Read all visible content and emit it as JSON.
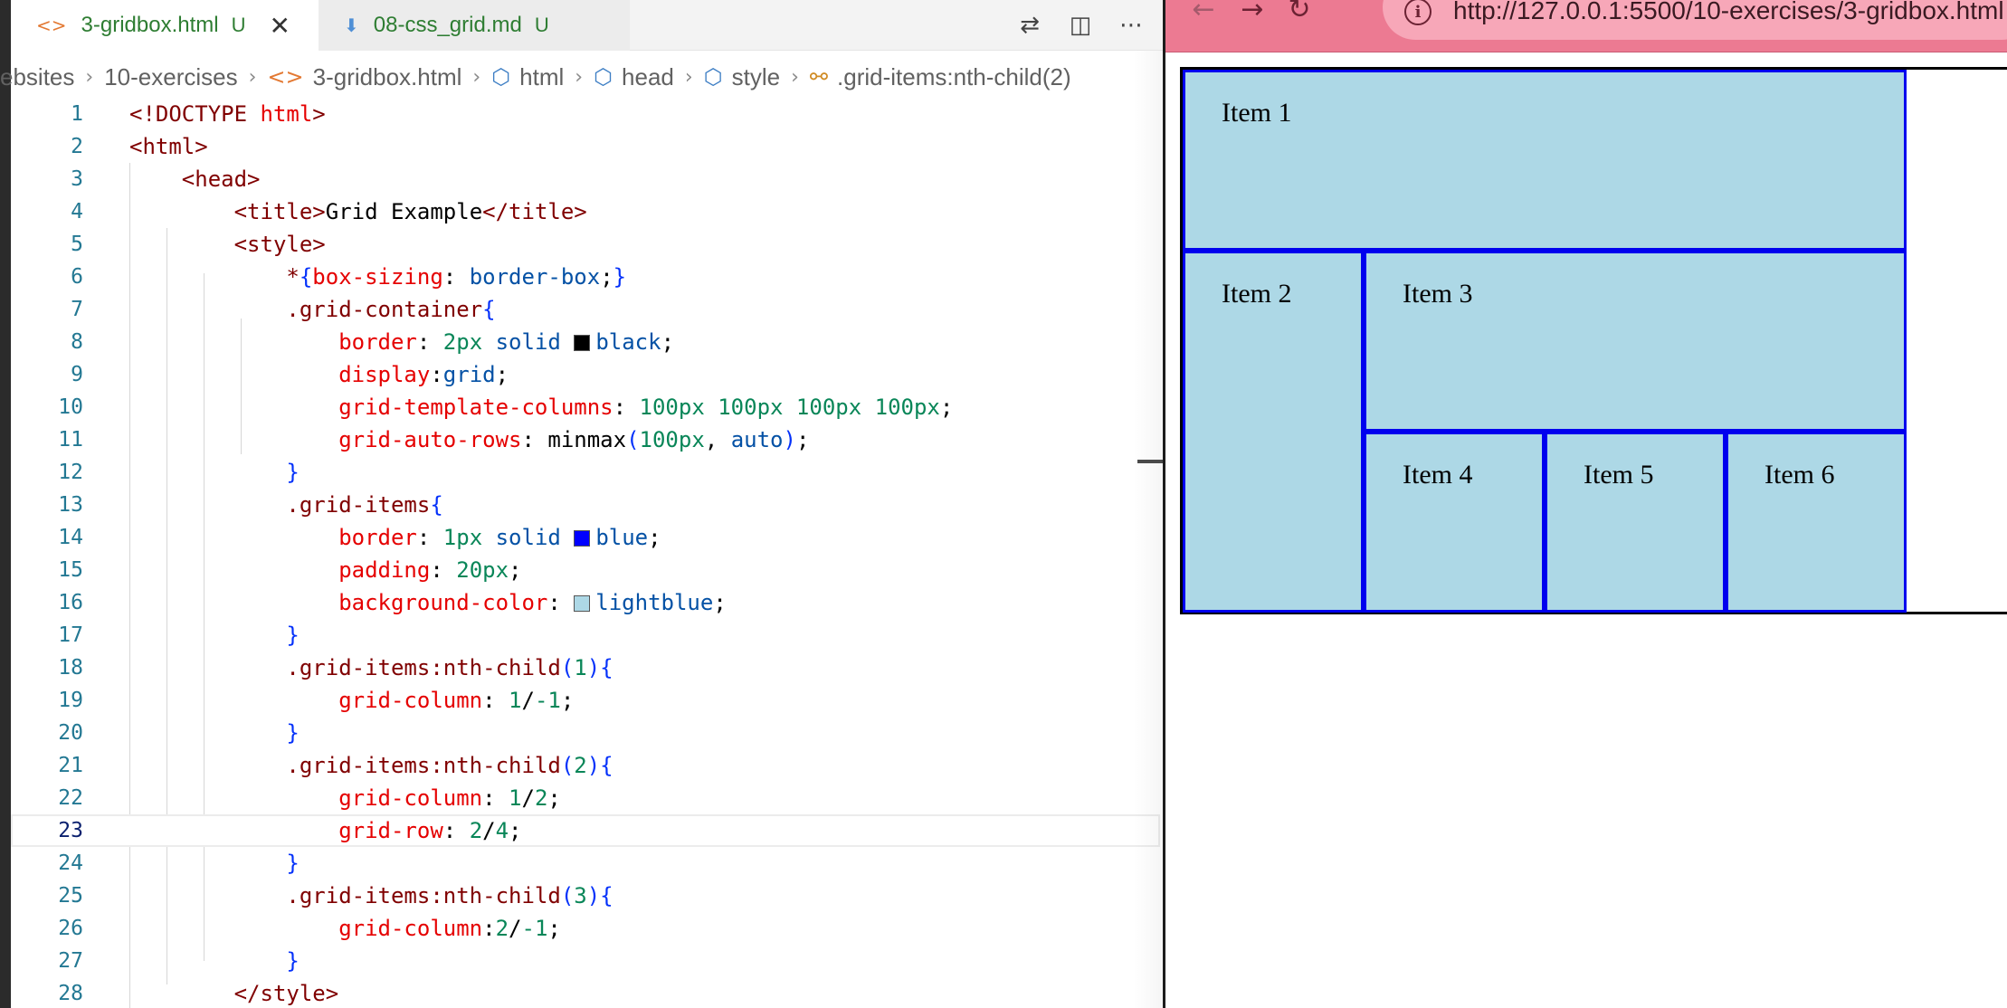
{
  "editor": {
    "tabs": [
      {
        "label": "3-gridbox.html",
        "status": "U",
        "icon": "html-file-icon",
        "active": true
      },
      {
        "label": "08-css_grid.md",
        "status": "U",
        "icon": "markdown-file-icon",
        "active": false
      }
    ],
    "breadcrumb": [
      "ebsites",
      "10-exercises",
      "3-gridbox.html",
      "html",
      "head",
      "style",
      ".grid-items:nth-child(2)"
    ],
    "current_line": 23
  },
  "browser": {
    "url": "http://127.0.0.1:5500/10-exercises/3-gridbox.html",
    "grid_items": [
      "Item 1",
      "Item 2",
      "Item 3",
      "Item 4",
      "Item 5",
      "Item 6"
    ]
  },
  "colors": {
    "browser_toolbar": "#ec7a92",
    "grid_item_bg": "#add8e6",
    "grid_item_border": "#0000ee",
    "container_border": "#000000"
  }
}
